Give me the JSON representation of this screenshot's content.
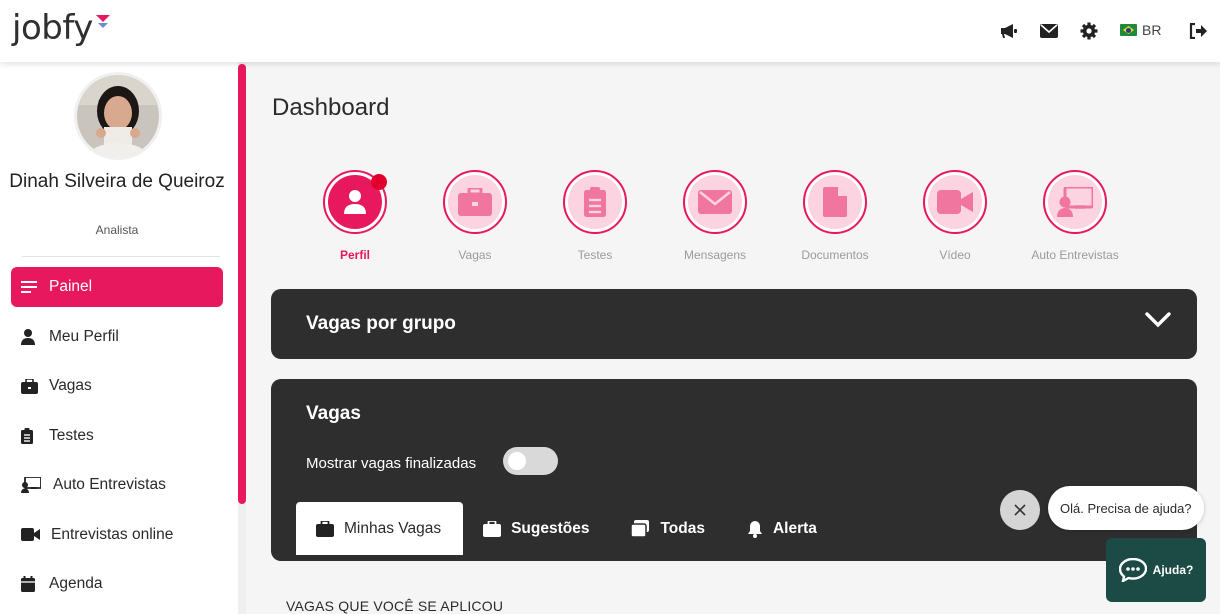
{
  "header": {
    "logo": "jobfy",
    "language": "BR"
  },
  "sidebar": {
    "user_name": "Dinah Silveira de Queiroz",
    "user_role": "Analista",
    "items": [
      {
        "label": "Painel",
        "icon": "menu-icon",
        "active": true
      },
      {
        "label": "Meu Perfil",
        "icon": "user-icon"
      },
      {
        "label": "Vagas",
        "icon": "briefcase-icon"
      },
      {
        "label": "Testes",
        "icon": "clipboard-icon"
      },
      {
        "label": "Auto Entrevistas",
        "icon": "presentation-icon"
      },
      {
        "label": "Entrevistas online",
        "icon": "video-icon"
      },
      {
        "label": "Agenda",
        "icon": "calendar-icon"
      }
    ]
  },
  "main": {
    "title": "Dashboard",
    "steps": [
      {
        "label": "Perfil",
        "icon": "user-icon",
        "active": true
      },
      {
        "label": "Vagas",
        "icon": "briefcase-icon"
      },
      {
        "label": "Testes",
        "icon": "clipboard-icon"
      },
      {
        "label": "Mensagens",
        "icon": "envelope-icon"
      },
      {
        "label": "Documentos",
        "icon": "file-icon"
      },
      {
        "label": "Vídeo",
        "icon": "video-icon"
      },
      {
        "label": "Auto Entrevistas",
        "icon": "presentation-icon"
      }
    ],
    "group_panel_title": "Vagas por grupo",
    "vagas_panel": {
      "title": "Vagas",
      "toggle_label": "Mostrar vagas finalizadas",
      "tabs": [
        "Minhas Vagas",
        "Sugestões",
        "Todas",
        "Alerta"
      ]
    },
    "section_heading": "VAGAS QUE VOCÊ SE APLICOU"
  },
  "help": {
    "bubble": "Olá. Precisa de ajuda?",
    "button": "Ajuda?"
  },
  "colors": {
    "accent": "#e8185e",
    "panel": "#2f2e2e",
    "help": "#1c4a44"
  }
}
